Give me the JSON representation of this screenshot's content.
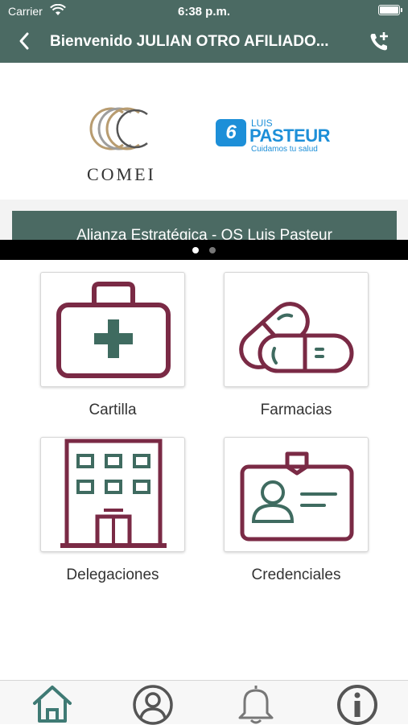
{
  "status_bar": {
    "carrier": "Carrier",
    "time": "6:38 p.m."
  },
  "header": {
    "title": "Bienvenido JULIAN OTRO AFILIADO..."
  },
  "logos": {
    "comei": {
      "text": "COMEI"
    },
    "pasteur": {
      "badge": "6",
      "luis": "LUIS",
      "name": "PASTEUR",
      "tagline": "Cuidamos tu salud"
    }
  },
  "banner": {
    "text": "Alianza Estratégica - OS Luis Pasteur",
    "active_page": 1,
    "pages": 2
  },
  "menu": [
    {
      "label": "Cartilla",
      "icon": "medical-kit-icon"
    },
    {
      "label": "Farmacias",
      "icon": "pills-icon"
    },
    {
      "label": "Delegaciones",
      "icon": "building-icon"
    },
    {
      "label": "Credenciales",
      "icon": "id-card-icon"
    }
  ],
  "tabbar": {
    "items": [
      "home-icon",
      "profile-icon",
      "notifications-icon",
      "info-icon"
    ],
    "active": "home-icon"
  },
  "colors": {
    "header": "#4b6a63",
    "icon_primary": "#7a2a45",
    "icon_secondary": "#3f6b60",
    "active_tab": "#3f7a74",
    "pasteur_blue": "#1d8fd8"
  }
}
